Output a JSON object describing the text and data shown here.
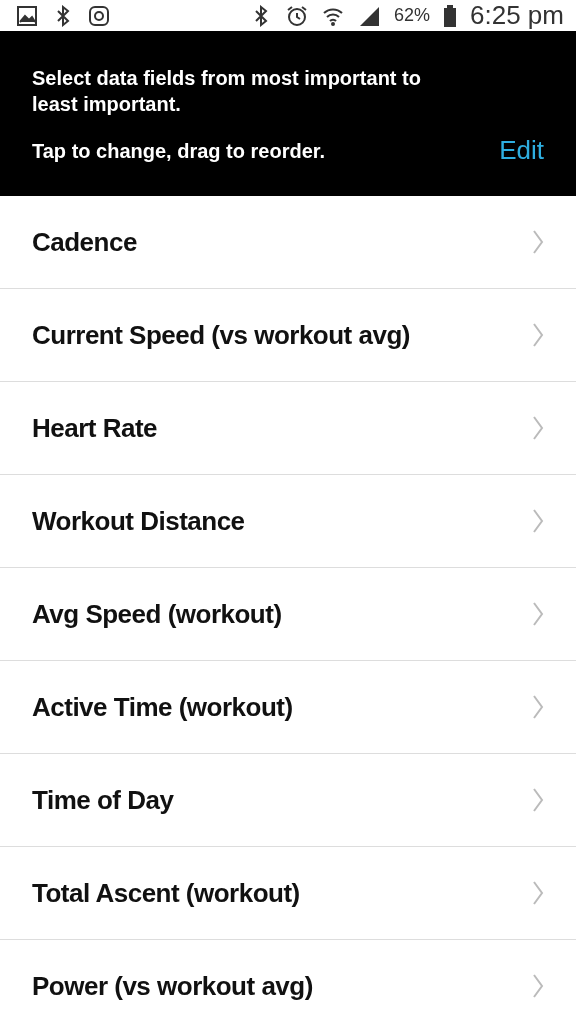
{
  "status_bar": {
    "battery": "62%",
    "time": "6:25 pm"
  },
  "header": {
    "instruction": "Select data fields from most important to least important.",
    "hint": "Tap to change, drag to reorder.",
    "edit": "Edit"
  },
  "fields": [
    {
      "label": "Cadence"
    },
    {
      "label": "Current Speed (vs workout avg)"
    },
    {
      "label": "Heart Rate"
    },
    {
      "label": "Workout Distance"
    },
    {
      "label": "Avg Speed (workout)"
    },
    {
      "label": "Active Time (workout)"
    },
    {
      "label": "Time of Day"
    },
    {
      "label": "Total Ascent (workout)"
    },
    {
      "label": "Power (vs workout avg)"
    }
  ]
}
